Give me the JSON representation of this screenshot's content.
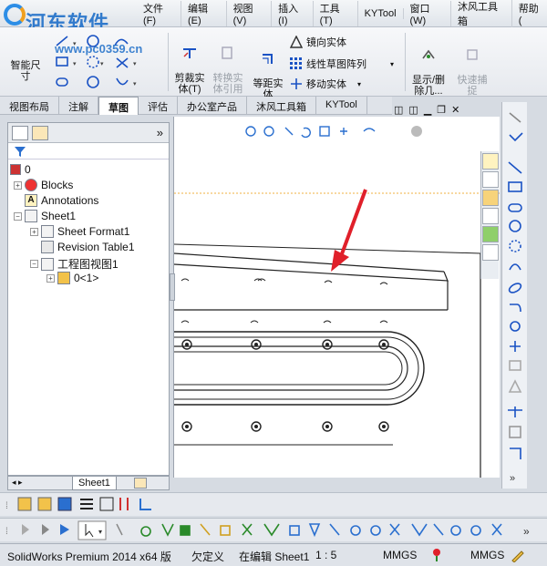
{
  "menu": {
    "watermark": "河东软件网",
    "watermark_url": "www.pc0359.cn",
    "items": [
      "文件(F)",
      "编辑(E)",
      "视图(V)",
      "插入(I)",
      "工具(T)",
      "KYTool",
      "窗口(W)",
      "沐风工具箱",
      "帮助("
    ]
  },
  "commands": {
    "smart_dim": "智能尺\n寸",
    "trim": "剪裁实\n体(T)",
    "convert": "转换实\n体引用",
    "offset": "等距实\n体",
    "mirror": "镜向实体",
    "linear_pattern": "线性草图阵列",
    "move": "移动实体",
    "show_delete": "显示/删\n除几...",
    "quick_snap": "快速捕\n捉"
  },
  "tabs": {
    "items": [
      "视图布局",
      "注解",
      "草图",
      "评估",
      "办公室产品",
      "沐风工具箱",
      "KYTool"
    ],
    "active_index": 2
  },
  "tree": {
    "root": "0",
    "blocks": "Blocks",
    "annotations": "Annotations",
    "sheet1": "Sheet1",
    "sheet_format": "Sheet Format1",
    "revision_table": "Revision Table1",
    "drawing_view": "工程图视图1",
    "part": "0<1>",
    "expand_glyph": "»"
  },
  "sheet_tab": "Sheet1",
  "status": {
    "product": "SolidWorks Premium 2014 x64 版",
    "definition": "欠定义",
    "editing": "在编辑 Sheet1",
    "scale": "1 : 5",
    "units1": "MMGS",
    "units2": "MMGS"
  },
  "colors": {
    "arrow": "#e0202a",
    "accent": "#1f6fc9",
    "dashed_line": "#f0b040"
  }
}
